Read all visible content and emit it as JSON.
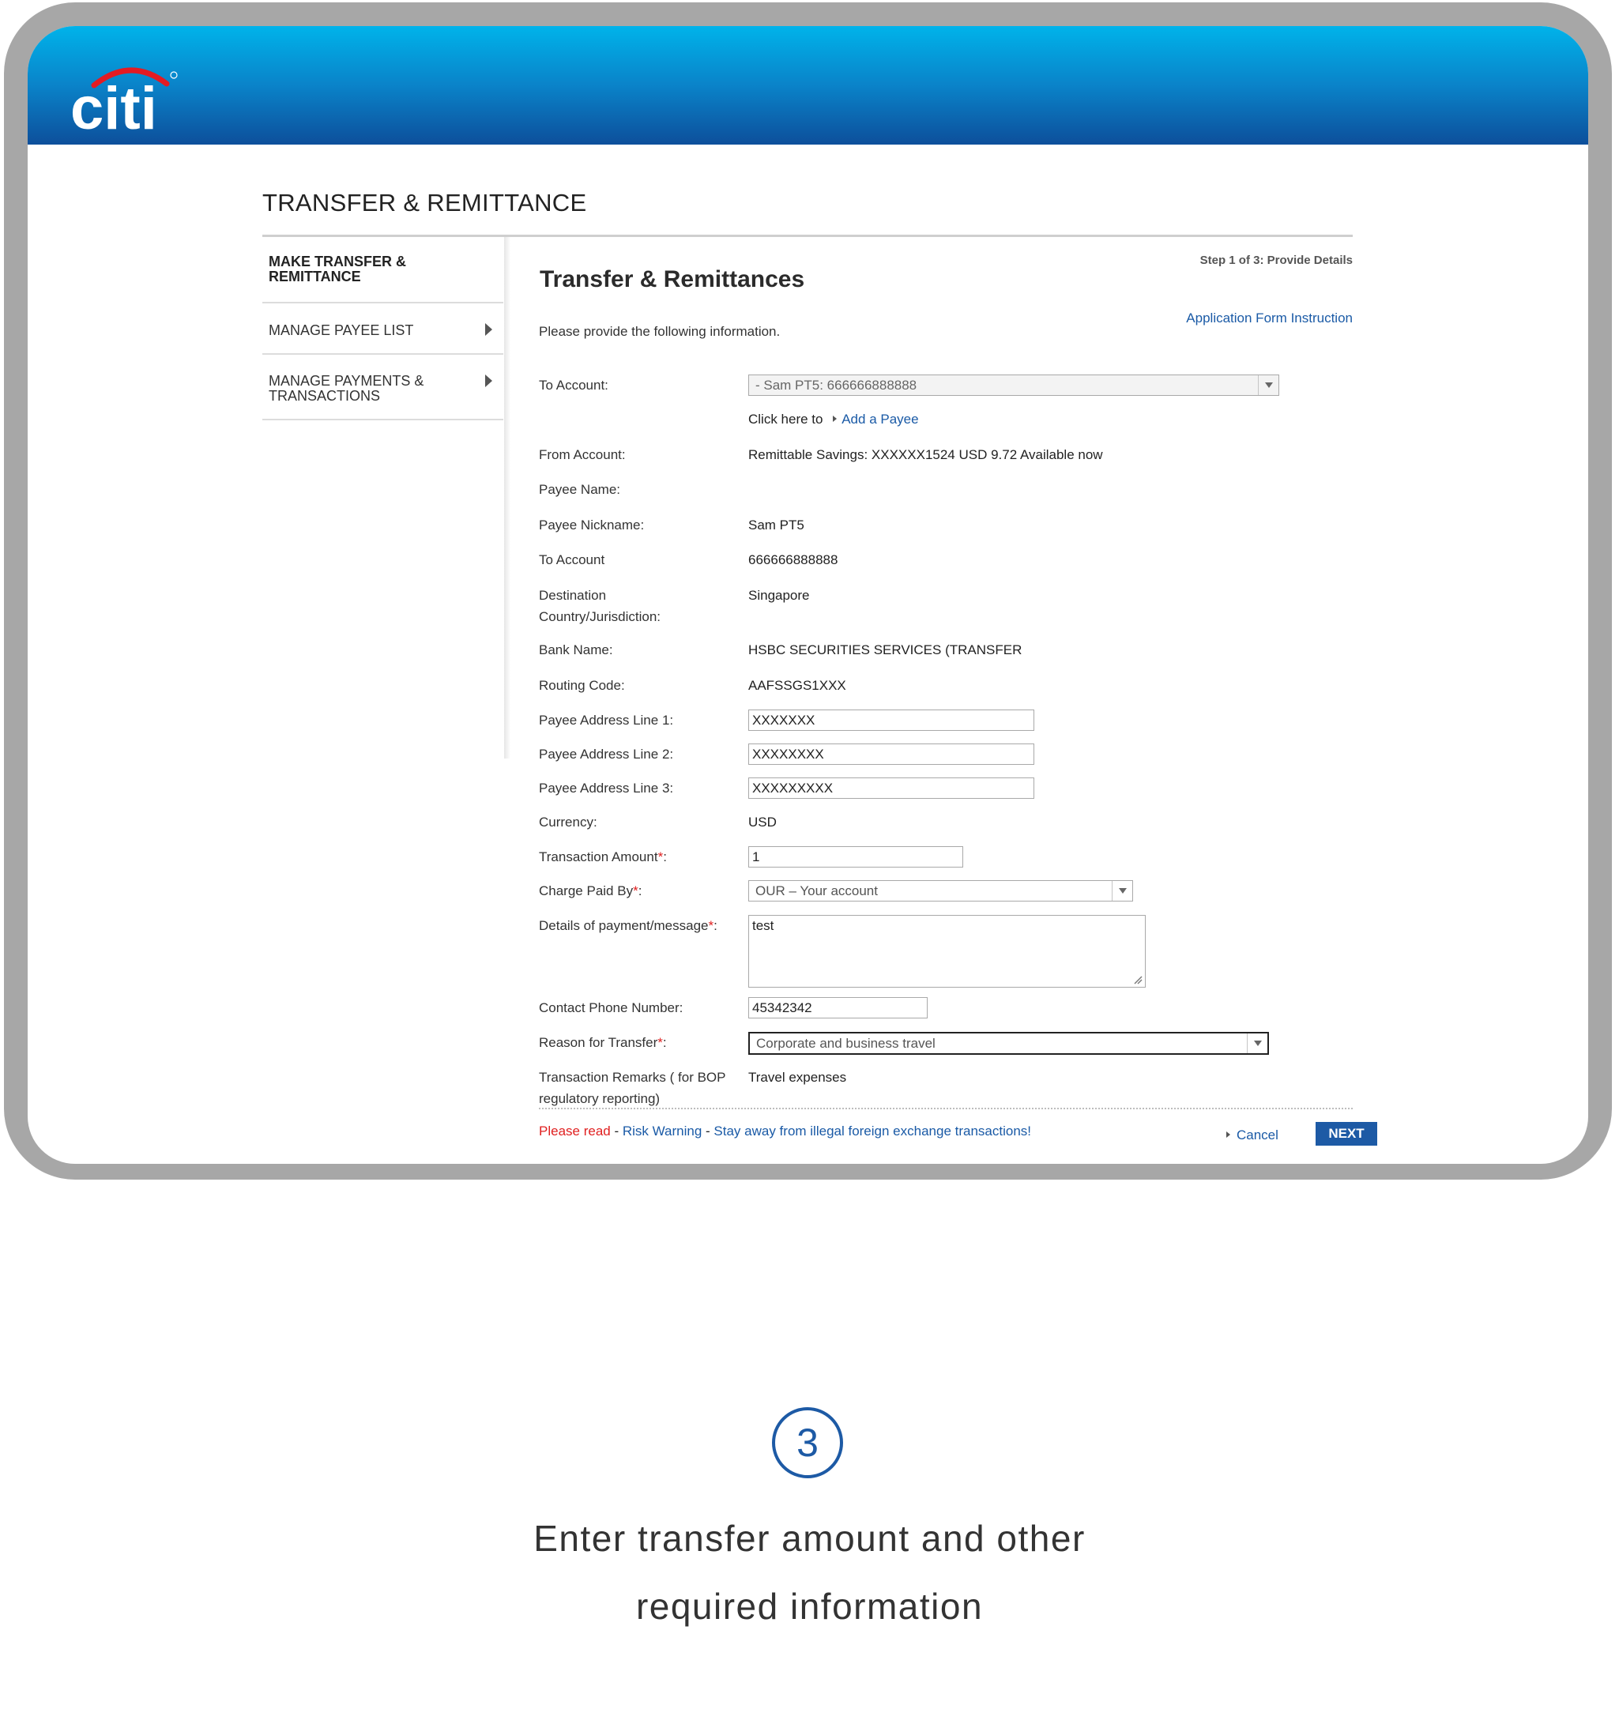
{
  "brand": {
    "logo_text": "citi",
    "colors": {
      "header_top": "#00b3ea",
      "header_bottom": "#0d4f9b",
      "logo_arc": "#e31b23",
      "link": "#1a5aa6",
      "button": "#1d5aa5",
      "required": "#e02020"
    }
  },
  "page": {
    "section_title": "TRANSFER & REMITTANCE"
  },
  "sidebar": {
    "items": [
      {
        "label": "MAKE TRANSFER & REMITTANCE",
        "active": true
      },
      {
        "label": "MANAGE PAYEE LIST",
        "icon": "chevron-right-icon"
      },
      {
        "label": "MANAGE PAYMENTS & TRANSACTIONS",
        "icon": "chevron-right-icon"
      }
    ]
  },
  "main": {
    "title": "Transfer & Remittances",
    "step": "Step 1 of 3: Provide Details",
    "app_form_link": "Application Form Instruction",
    "intro": "Please provide the following information."
  },
  "form": {
    "to_account_label": "To Account:",
    "to_account_value": "- Sam PT5: 666666888888",
    "click_here": "Click here to",
    "add_payee": "Add a Payee",
    "from_account_label": "From Account:",
    "from_account_value": "Remittable Savings: XXXXXX1524 USD 9.72 Available now",
    "payee_name_label": "Payee Name:",
    "payee_nickname_label": "Payee Nickname:",
    "payee_nickname_value": "Sam PT5",
    "to_account2_label": "To Account",
    "to_account2_value": "666666888888",
    "destination_label_1": "Destination",
    "destination_label_2": "Country/Jurisdiction:",
    "destination_value": "Singapore",
    "bank_name_label": "Bank Name:",
    "bank_name_value": "HSBC SECURITIES SERVICES (TRANSFER",
    "routing_label": "Routing Code:",
    "routing_value": "AAFSSGS1XXX",
    "addr1_label": "Payee Address Line 1:",
    "addr1_value": "XXXXXXX",
    "addr2_label": "Payee Address Line 2:",
    "addr2_value": "XXXXXXXX",
    "addr3_label": "Payee Address Line 3:",
    "addr3_value": "XXXXXXXXX",
    "currency_label": "Currency:",
    "currency_value": "USD",
    "amount_label": "Transaction Amount",
    "amount_value": "1",
    "charge_label": "Charge Paid By",
    "charge_value": "OUR – Your account",
    "details_label": "Details of payment/message",
    "details_value": "test",
    "phone_label": "Contact Phone Number:",
    "phone_value": "45342342",
    "reason_label": "Reason for Transfer",
    "reason_value": "Corporate and business travel",
    "remarks_label_1": "Transaction Remarks ( for BOP",
    "remarks_label_2": "regulatory reporting)",
    "remarks_value": "Travel expenses",
    "required_mark": "*",
    "colon": ":"
  },
  "footer": {
    "please_read": "Please read",
    "sep1": " - ",
    "risk_warning": "Risk Warning",
    "sep2": " - ",
    "stay_away": "Stay away from illegal foreign exchange transactions!",
    "cancel": "Cancel",
    "next": "NEXT"
  },
  "step_badge": {
    "number": "3"
  },
  "caption": {
    "line1": "Enter transfer amount and other",
    "line2": "required information"
  }
}
